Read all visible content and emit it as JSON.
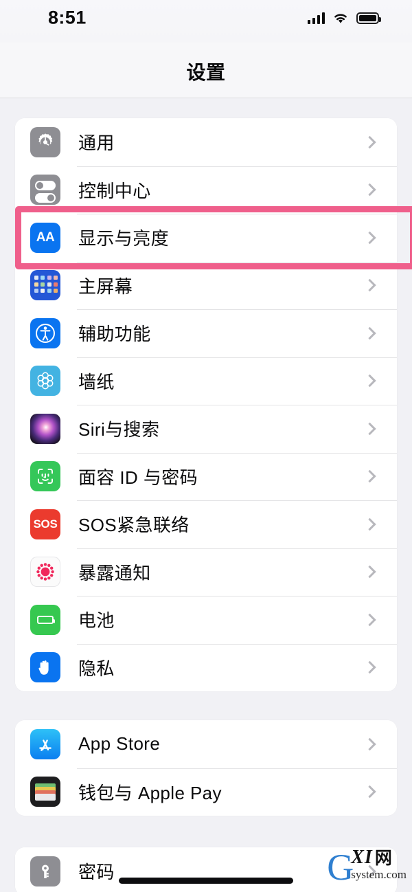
{
  "status_bar": {
    "time": "8:51",
    "cellular_icon": "signal-bars-icon",
    "wifi_icon": "wifi-icon",
    "battery_icon": "battery-full-icon"
  },
  "header": {
    "title": "设置"
  },
  "highlight": {
    "target_row": "显示与亮度",
    "color": "#ef5f8b"
  },
  "groups": [
    {
      "id": "group-system",
      "rows": [
        {
          "label": "通用",
          "icon": "gear-icon",
          "accessory": "chevron-right-icon"
        },
        {
          "label": "控制中心",
          "icon": "control-center-icon",
          "accessory": "chevron-right-icon"
        },
        {
          "label": "显示与亮度",
          "icon": "display-brightness-icon",
          "accessory": "chevron-right-icon"
        },
        {
          "label": "主屏幕",
          "icon": "home-screen-icon",
          "accessory": "chevron-right-icon"
        },
        {
          "label": "辅助功能",
          "icon": "accessibility-icon",
          "accessory": "chevron-right-icon"
        },
        {
          "label": "墙纸",
          "icon": "wallpaper-icon",
          "accessory": "chevron-right-icon"
        },
        {
          "label": "Siri与搜索",
          "icon": "siri-icon",
          "accessory": "chevron-right-icon"
        },
        {
          "label": "面容 ID 与密码",
          "icon": "face-id-icon",
          "accessory": "chevron-right-icon"
        },
        {
          "label": "SOS紧急联络",
          "icon": "sos-icon",
          "accessory": "chevron-right-icon"
        },
        {
          "label": "暴露通知",
          "icon": "exposure-notification-icon",
          "accessory": "chevron-right-icon"
        },
        {
          "label": "电池",
          "icon": "battery-icon",
          "accessory": "chevron-right-icon"
        },
        {
          "label": "隐私",
          "icon": "privacy-hand-icon",
          "accessory": "chevron-right-icon"
        }
      ]
    },
    {
      "id": "group-store",
      "rows": [
        {
          "label": "App Store",
          "icon": "app-store-icon",
          "accessory": "chevron-right-icon"
        },
        {
          "label": "钱包与 Apple Pay",
          "icon": "wallet-icon",
          "accessory": "chevron-right-icon"
        }
      ]
    },
    {
      "id": "group-passwords",
      "rows": [
        {
          "label": "密码",
          "icon": "passwords-key-icon",
          "accessory": "chevron-right-icon"
        }
      ]
    }
  ],
  "watermark": {
    "letter": "G",
    "mid": "XI",
    "cjk": "网",
    "domain": "system.com"
  }
}
